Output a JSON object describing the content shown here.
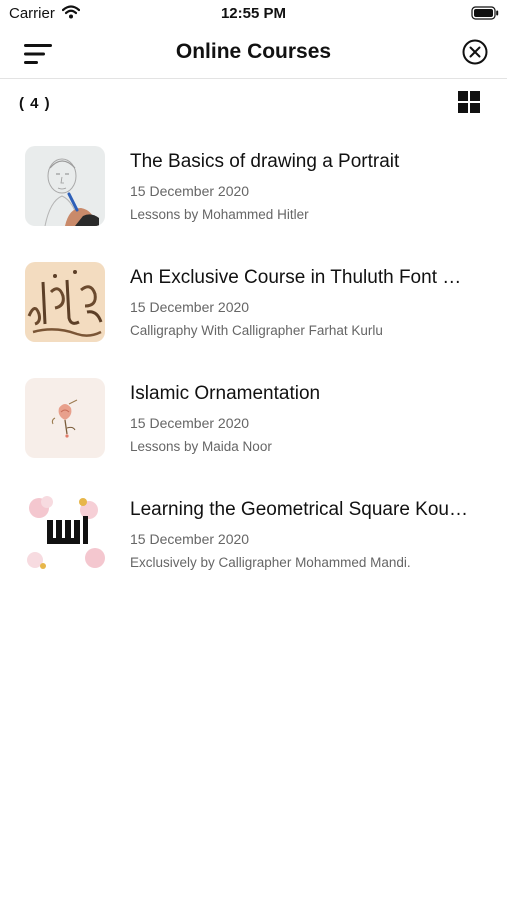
{
  "status_bar": {
    "carrier": "Carrier",
    "time": "12:55 PM",
    "icons": [
      "wifi-icon",
      "battery-icon"
    ]
  },
  "nav": {
    "title": "Online Courses",
    "left_icon": "menu-sort-icon",
    "right_icon": "close-circle-icon"
  },
  "toolbar": {
    "count": "( 4 )",
    "view_icon": "grid-view-icon"
  },
  "courses": [
    {
      "title": "The Basics of drawing a Portrait",
      "date": "15 December 2020",
      "author": "Lessons by  Mohammed Hitler",
      "thumb_icon": "portrait-sketch-thumbnail"
    },
    {
      "title": "An Exclusive Course in Thuluth Font Ca...",
      "date": "15 December 2020",
      "author": "Calligraphy With Calligrapher Farhat Kurlu",
      "thumb_icon": "calligraphy-thumbnail"
    },
    {
      "title": "Islamic Ornamentation",
      "date": "15 December 2020",
      "author": "Lessons by Maida Noor",
      "thumb_icon": "ornament-flower-thumbnail"
    },
    {
      "title": "Learning the Geometrical Square Koufi...",
      "date": "15 December 2020",
      "author": "Exclusively by Calligrapher Mohammed Mandi.",
      "thumb_icon": "koufi-floral-thumbnail"
    }
  ]
}
